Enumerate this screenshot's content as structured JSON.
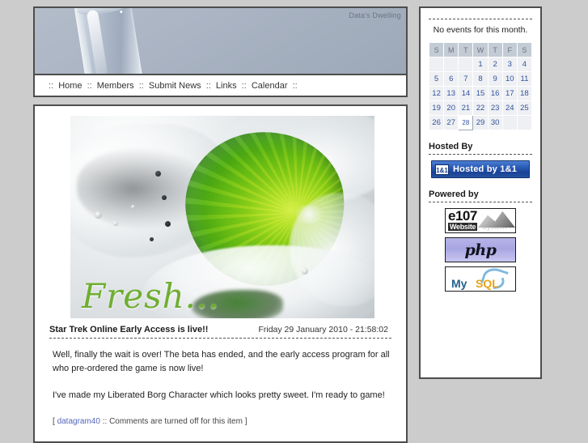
{
  "site": {
    "title": "Data's Dwelling",
    "background_color": "#cccccc",
    "panel_border_color": "#4d4d4d"
  },
  "nav": {
    "separator": "::",
    "items": [
      {
        "label": "Home"
      },
      {
        "label": "Members"
      },
      {
        "label": "Submit News"
      },
      {
        "label": "Links"
      },
      {
        "label": "Calendar"
      }
    ]
  },
  "main": {
    "feature_image": {
      "alt": "Lime slice splashing into water",
      "caption": "Fresh..."
    },
    "news": {
      "title": "Star Trek Online Early Access is live!!",
      "date": "Friday 29 January 2010 - 21:58:02",
      "paragraphs": [
        "Well, finally the wait is over! The beta has ended, and the early access program for all who pre-ordered the game is now live!",
        "I've made my Liberated Borg Character which looks pretty sweet. I'm ready to game!"
      ],
      "footer_open": "[",
      "author": "datagram40",
      "footer_separator": "::",
      "comments_status": "Comments are turned off for this item",
      "footer_close": "]"
    }
  },
  "sidebar": {
    "calendar_block": {
      "heading": "",
      "note": "No events for this month.",
      "weekday_headers": [
        "S",
        "M",
        "T",
        "W",
        "T",
        "F",
        "S"
      ],
      "weeks": [
        [
          "",
          "",
          "",
          "1",
          "2",
          "3",
          "4"
        ],
        [
          "5",
          "6",
          "7",
          "8",
          "9",
          "10",
          "11"
        ],
        [
          "12",
          "13",
          "14",
          "15",
          "16",
          "17",
          "18"
        ],
        [
          "19",
          "20",
          "21",
          "22",
          "23",
          "24",
          "25"
        ],
        [
          "26",
          "27",
          "28",
          "29",
          "30",
          "",
          ""
        ]
      ],
      "today": "28",
      "day_color": "#33529e",
      "header_bg": "#c3cbd5"
    },
    "hosted_block": {
      "heading": "Hosted By",
      "badge": {
        "mark": "1&1",
        "label": "Hosted by 1&1",
        "color": "#1b4398"
      }
    },
    "powered_block": {
      "heading": "Powered by",
      "badges": [
        {
          "name": "e107",
          "line1": "e107",
          "line2": "Website",
          "line3": "System"
        },
        {
          "name": "php",
          "label": "php"
        },
        {
          "name": "mysql",
          "label_a": "My",
          "label_b": "SQL"
        }
      ]
    }
  }
}
